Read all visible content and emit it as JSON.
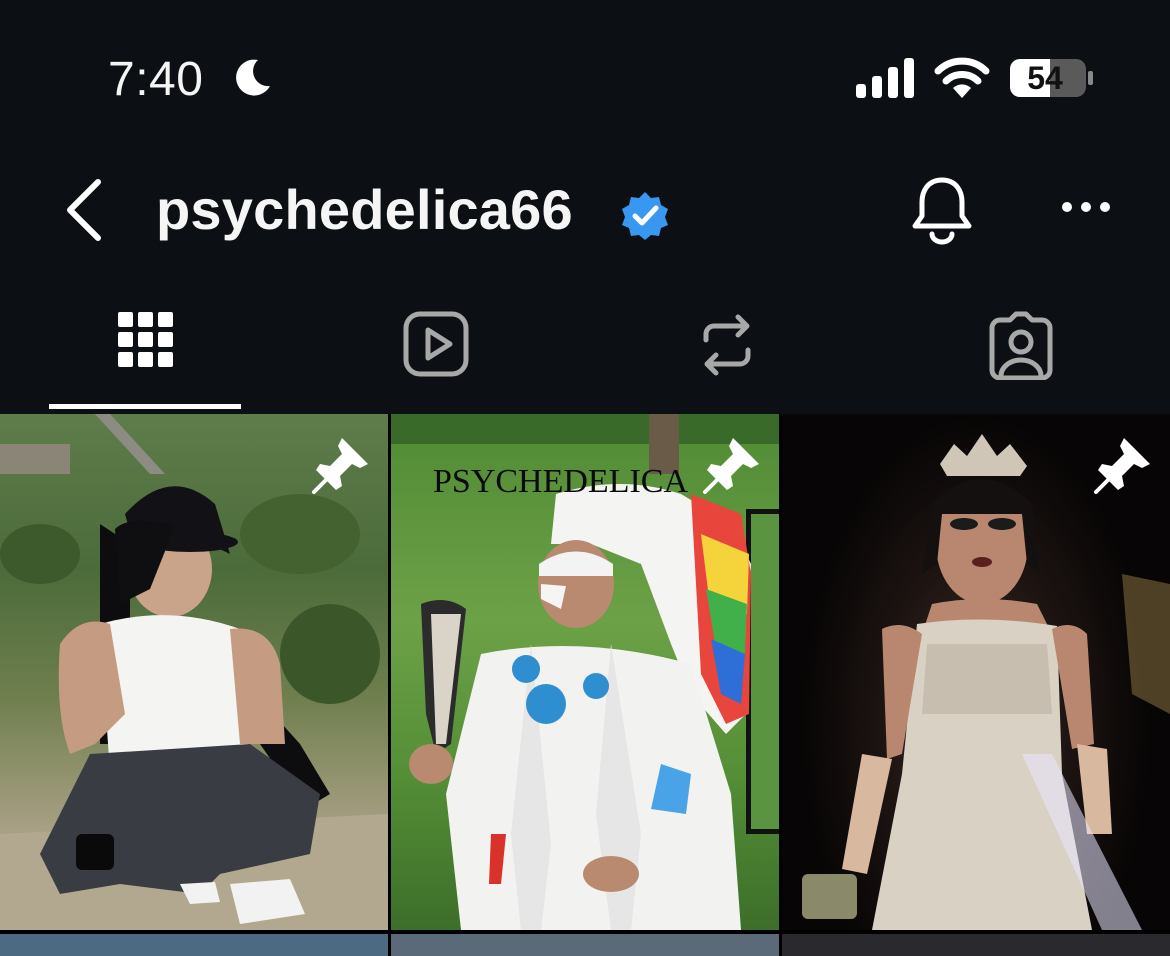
{
  "status_bar": {
    "time": "7:40",
    "battery": "54"
  },
  "header": {
    "username": "psychedelica66",
    "verified": true
  },
  "tabs": [
    {
      "icon": "grid-icon",
      "active": true
    },
    {
      "icon": "reels-icon",
      "active": false
    },
    {
      "icon": "repost-icon",
      "active": false
    },
    {
      "icon": "tagged-icon",
      "active": false
    }
  ],
  "posts": [
    {
      "pinned": true
    },
    {
      "pinned": true,
      "caption_text": "PSYCHEDELICA"
    },
    {
      "pinned": true
    }
  ],
  "colors": {
    "background": "#0c1014",
    "verified_blue": "#3897f0",
    "icon_gray": "#a8a8a8"
  }
}
